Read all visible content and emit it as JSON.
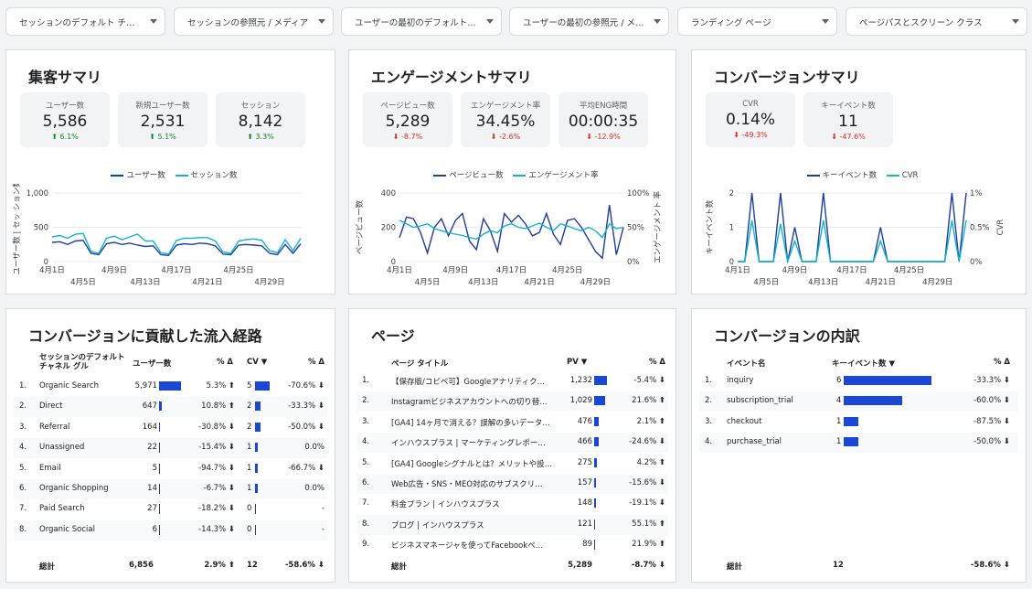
{
  "filters": [
    "セッションのデフォルト チャ…",
    "セッションの参照元 / メディア",
    "ユーザーの最初のデフォルト…",
    "ユーザーの最初の参照元 / メデ…",
    "ランディング ページ",
    "ページパスとスクリーン クラス"
  ],
  "acquisition": {
    "title": "集客サマリ",
    "kpis": [
      {
        "label": "ユーザー数",
        "value": "5,586",
        "delta": "⬆ 6.1%",
        "dir": "up"
      },
      {
        "label": "新規ユーザー数",
        "value": "2,531",
        "delta": "⬆ 5.1%",
        "dir": "up"
      },
      {
        "label": "セッション",
        "value": "8,142",
        "delta": "⬆ 3.3%",
        "dir": "up"
      }
    ],
    "legend": [
      "ユーザー数",
      "セッション数"
    ],
    "ylabel": "ユーザー数 | セッ ション数"
  },
  "engagement": {
    "title": "エンゲージメントサマリ",
    "kpis": [
      {
        "label": "ページビュー数",
        "value": "5,289",
        "delta": "⬇ -8.7%",
        "dir": "down"
      },
      {
        "label": "エンゲージメント率",
        "value": "34.45%",
        "delta": "⬇ -2.6%",
        "dir": "down"
      },
      {
        "label": "平均ENG時間",
        "value": "00:00:35",
        "delta": "⬇ -12.9%",
        "dir": "down"
      }
    ],
    "legend": [
      "ページビュー数",
      "エンゲージメント率"
    ],
    "ylabel_left": "ページビュー数",
    "ylabel_right": "エンゲージメント 率"
  },
  "conversion": {
    "title": "コンバージョンサマリ",
    "kpis": [
      {
        "label": "CVR",
        "value": "0.14%",
        "delta": "⬇ -49.3%",
        "dir": "down"
      },
      {
        "label": "キーイベント数",
        "value": "11",
        "delta": "⬇ -47.6%",
        "dir": "down"
      }
    ],
    "legend": [
      "キーイベント数",
      "CVR"
    ],
    "ylabel_left": "キーイベント数",
    "ylabel_right": "CVR"
  },
  "colors": {
    "dark": "#1f3d9c",
    "teal": "#12b5cb",
    "bar": "#1a47d6",
    "up": "#188038",
    "down": "#d93025"
  },
  "chart_data": [
    {
      "type": "line",
      "x_ticks_top": [
        "4月1日",
        "4月9日",
        "4月17日",
        "4月25日"
      ],
      "x_ticks_bottom": [
        "4月5日",
        "4月13日",
        "4月21日",
        "4月29日"
      ],
      "y_ticks": [
        "1,000",
        "500",
        "0"
      ],
      "ylim": [
        0,
        1000
      ],
      "series": [
        {
          "name": "ユーザー数",
          "color": "#1f3d9c",
          "values": [
            280,
            290,
            250,
            300,
            310,
            120,
            100,
            260,
            280,
            250,
            270,
            240,
            220,
            230,
            100,
            90,
            240,
            260,
            250,
            270,
            260,
            230,
            110,
            100,
            240,
            250,
            240,
            230,
            120,
            100,
            250,
            120,
            260
          ]
        },
        {
          "name": "セッション数",
          "color": "#12b5cb",
          "values": [
            360,
            380,
            340,
            400,
            410,
            150,
            120,
            340,
            370,
            320,
            360,
            400,
            300,
            300,
            130,
            110,
            310,
            340,
            340,
            350,
            350,
            300,
            140,
            120,
            300,
            320,
            330,
            310,
            160,
            130,
            320,
            160,
            340
          ]
        }
      ]
    },
    {
      "type": "line",
      "x_ticks_top": [
        "4月1日",
        "4月9日",
        "4月17日",
        "4月25日"
      ],
      "x_ticks_bottom": [
        "4月5日",
        "4月13日",
        "4月21日",
        "4月29日"
      ],
      "y_ticks_left": [
        "400",
        "200",
        "0"
      ],
      "y_ticks_right": [
        "100%",
        "50%",
        "0%"
      ],
      "ylim_left": [
        0,
        400
      ],
      "ylim_right": [
        0,
        100
      ],
      "series": [
        {
          "name": "ページビュー数",
          "color": "#1f3d9c",
          "axis": "left",
          "values": [
            140,
            260,
            250,
            170,
            50,
            200,
            250,
            150,
            240,
            280,
            120,
            70,
            250,
            180,
            60,
            280,
            230,
            270,
            220,
            150,
            170,
            280,
            160,
            100,
            240,
            250,
            200,
            130,
            60,
            20,
            330,
            40,
            200
          ]
        },
        {
          "name": "エンゲージメント率",
          "color": "#12b5cb",
          "axis": "right",
          "values": [
            60,
            55,
            50,
            52,
            55,
            48,
            45,
            42,
            40,
            38,
            35,
            33,
            40,
            45,
            42,
            52,
            55,
            50,
            48,
            52,
            56,
            50,
            45,
            55,
            52,
            48,
            45,
            50,
            45,
            35,
            55,
            48,
            50
          ]
        }
      ]
    },
    {
      "type": "line",
      "x_ticks_top": [
        "4月1日",
        "4月9日",
        "4月17日",
        "4月25日"
      ],
      "x_ticks_bottom": [
        "4月5日",
        "4月13日",
        "4月21日",
        "4月29日"
      ],
      "y_ticks_left": [
        "2",
        "1",
        "0"
      ],
      "y_ticks_right": [
        "1%",
        "0.5%",
        "0%"
      ],
      "ylim_left": [
        0,
        2
      ],
      "ylim_right": [
        0,
        1
      ],
      "series": [
        {
          "name": "キーイベント数",
          "color": "#1f3d9c",
          "axis": "left",
          "values": [
            0,
            0,
            2,
            0,
            0,
            0,
            2,
            0,
            1,
            0,
            0,
            0,
            2,
            0,
            0,
            0,
            0,
            0,
            0,
            0,
            1,
            0,
            0,
            0,
            0,
            0,
            0,
            0,
            0,
            0,
            2,
            0,
            2
          ]
        },
        {
          "name": "CVR",
          "color": "#12b5cb",
          "axis": "right",
          "values": [
            0,
            0,
            0.6,
            0,
            0,
            0,
            0.55,
            0,
            0.3,
            0,
            0,
            0,
            0.6,
            0,
            0,
            0,
            0,
            0,
            0,
            0,
            0.3,
            0,
            0,
            0,
            0,
            0,
            0,
            0,
            0,
            0,
            0.6,
            0,
            0.6
          ]
        }
      ]
    },
    {
      "type": "table",
      "title": "コンバージョンに貢献した流入経路",
      "columns": [
        "セッションのデフォルト チャネル グル",
        "ユーザー数",
        "% Δ",
        "CV ▼",
        "% Δ"
      ],
      "rows": [
        {
          "n": "1.",
          "name": "Organic Search",
          "users": "5,971",
          "users_v": 5971,
          "ud": "5.3% ⬆",
          "ud_dir": "up",
          "cv": "5",
          "cv_v": 5,
          "cd": "-70.6% ⬇",
          "cd_dir": "down"
        },
        {
          "n": "2.",
          "name": "Direct",
          "users": "647",
          "users_v": 647,
          "ud": "10.8% ⬆",
          "ud_dir": "up",
          "cv": "2",
          "cv_v": 2,
          "cd": "-33.3% ⬇",
          "cd_dir": "down"
        },
        {
          "n": "3.",
          "name": "Referral",
          "users": "164",
          "users_v": 164,
          "ud": "-30.8% ⬇",
          "ud_dir": "down",
          "cv": "2",
          "cv_v": 2,
          "cd": "-50.0% ⬇",
          "cd_dir": "down"
        },
        {
          "n": "4.",
          "name": "Unassigned",
          "users": "22",
          "users_v": 22,
          "ud": "-15.4% ⬇",
          "ud_dir": "down",
          "cv": "1",
          "cv_v": 1,
          "cd": "0.0%",
          "cd_dir": ""
        },
        {
          "n": "5.",
          "name": "Email",
          "users": "5",
          "users_v": 5,
          "ud": "-94.7% ⬇",
          "ud_dir": "down",
          "cv": "1",
          "cv_v": 1,
          "cd": "-66.7% ⬇",
          "cd_dir": "down"
        },
        {
          "n": "6.",
          "name": "Organic Shopping",
          "users": "14",
          "users_v": 14,
          "ud": "-6.7% ⬇",
          "ud_dir": "down",
          "cv": "1",
          "cv_v": 1,
          "cd": "0.0%",
          "cd_dir": ""
        },
        {
          "n": "7.",
          "name": "Paid Search",
          "users": "27",
          "users_v": 27,
          "ud": "-18.2% ⬇",
          "ud_dir": "down",
          "cv": "0",
          "cv_v": 0,
          "cd": "-",
          "cd_dir": ""
        },
        {
          "n": "8.",
          "name": "Organic Social",
          "users": "6",
          "users_v": 6,
          "ud": "-14.3% ⬇",
          "ud_dir": "down",
          "cv": "0",
          "cv_v": 0,
          "cd": "-",
          "cd_dir": ""
        }
      ],
      "total": {
        "label": "総計",
        "users": "6,856",
        "ud": "2.9% ⬆",
        "cv": "12",
        "cd": "-58.6% ⬇"
      }
    },
    {
      "type": "table",
      "title": "ページ",
      "columns": [
        "ページ タイトル",
        "PV ▼",
        "% Δ"
      ],
      "rows": [
        {
          "n": "1.",
          "name": "【保存版/コピペ可】Googleアナリティク…",
          "pv": "1,232",
          "pv_v": 1232,
          "d": "-5.4% ⬇",
          "d_dir": "down"
        },
        {
          "n": "2.",
          "name": "Instagramビジネスアカウントへの切り替…",
          "pv": "1,029",
          "pv_v": 1029,
          "d": "21.6% ⬆",
          "d_dir": "up"
        },
        {
          "n": "3.",
          "name": "[GA4] 14ヶ月で消える？誤解の多いデータ…",
          "pv": "476",
          "pv_v": 476,
          "d": "2.1% ⬆",
          "d_dir": "up"
        },
        {
          "n": "4.",
          "name": "インハウスプラス | マーケティングレポー…",
          "pv": "466",
          "pv_v": 466,
          "d": "-24.6% ⬇",
          "d_dir": "down"
        },
        {
          "n": "5.",
          "name": "[GA4] Googleシグナルとは？メリットや設…",
          "pv": "275",
          "pv_v": 275,
          "d": "4.2% ⬆",
          "d_dir": "up"
        },
        {
          "n": "6.",
          "name": "Web広告・SNS・MEO対応のサブスクリ…",
          "pv": "157",
          "pv_v": 157,
          "d": "-15.6% ⬇",
          "d_dir": "down"
        },
        {
          "n": "7.",
          "name": "料金プラン | インハウスプラス",
          "pv": "148",
          "pv_v": 148,
          "d": "-19.1% ⬇",
          "d_dir": "down"
        },
        {
          "n": "8.",
          "name": "ブログ | インハウスプラス",
          "pv": "121",
          "pv_v": 121,
          "d": "55.1% ⬆",
          "d_dir": "up"
        },
        {
          "n": "9.",
          "name": "ビジネスマネージャを使ってFacebookペ…",
          "pv": "89",
          "pv_v": 89,
          "d": "21.9% ⬆",
          "d_dir": "up"
        }
      ],
      "total": {
        "label": "総計",
        "pv": "5,289",
        "d": "-8.7% ⬇"
      }
    },
    {
      "type": "table",
      "title": "コンバージョンの内訳",
      "columns": [
        "イベント名",
        "キーイベント数 ▼",
        "% Δ"
      ],
      "rows": [
        {
          "n": "1.",
          "name": "inquiry",
          "v": "6",
          "v_v": 6,
          "d": "-33.3% ⬇",
          "d_dir": "down"
        },
        {
          "n": "2.",
          "name": "subscription_trial",
          "v": "4",
          "v_v": 4,
          "d": "-60.0% ⬇",
          "d_dir": "down"
        },
        {
          "n": "3.",
          "name": "checkout",
          "v": "1",
          "v_v": 1,
          "d": "-87.5% ⬇",
          "d_dir": "down"
        },
        {
          "n": "4.",
          "name": "purchase_trial",
          "v": "1",
          "v_v": 1,
          "d": "-50.0% ⬇",
          "d_dir": "down"
        }
      ],
      "total": {
        "label": "総計",
        "v": "12",
        "d": "-58.6% ⬇"
      }
    }
  ]
}
